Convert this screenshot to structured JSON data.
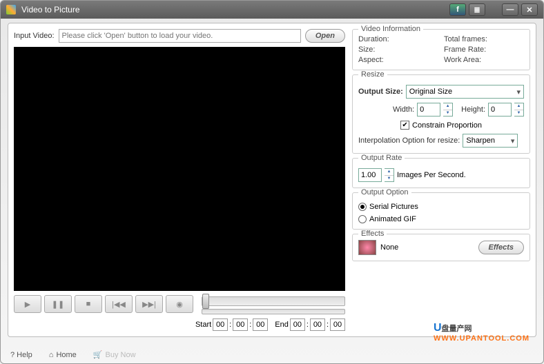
{
  "titlebar": {
    "title": "Video to Picture"
  },
  "input": {
    "label": "Input Video:",
    "placeholder": "Please click 'Open' button to load your video.",
    "open_btn": "Open"
  },
  "controls": {
    "play": "▶",
    "pause": "❚❚",
    "stop": "■",
    "prev": "|◀◀",
    "next": "▶▶|",
    "capture": "◉"
  },
  "time": {
    "start_label": "Start",
    "end_label": "End",
    "start_h": "00",
    "start_m": "00",
    "start_s": "00",
    "end_h": "00",
    "end_m": "00",
    "end_s": "00"
  },
  "info": {
    "legend": "Video Information",
    "duration_lbl": "Duration:",
    "totalframes_lbl": "Total frames:",
    "size_lbl": "Size:",
    "framerate_lbl": "Frame Rate:",
    "aspect_lbl": "Aspect:",
    "workarea_lbl": "Work Area:"
  },
  "resize": {
    "legend": "Resize",
    "outputsize_lbl": "Output Size:",
    "outputsize_val": "Original Size",
    "width_lbl": "Width:",
    "width_val": "0",
    "height_lbl": "Height:",
    "height_val": "0",
    "constrain_lbl": "Constrain Proportion",
    "interp_lbl": "Interpolation Option for resize:",
    "interp_val": "Sharpen"
  },
  "rate": {
    "legend": "Output Rate",
    "value": "1.00",
    "label": "Images Per Second."
  },
  "option": {
    "legend": "Output Option",
    "serial": "Serial Pictures",
    "gif": "Animated GIF"
  },
  "effects": {
    "legend": "Effects",
    "name": "None",
    "button": "Effects"
  },
  "footer": {
    "help": "? Help",
    "home": "Home",
    "buy": "Buy Now"
  },
  "watermark": {
    "cn": "盘量产网",
    "url": "WWW.UPANTOOL.COM"
  }
}
